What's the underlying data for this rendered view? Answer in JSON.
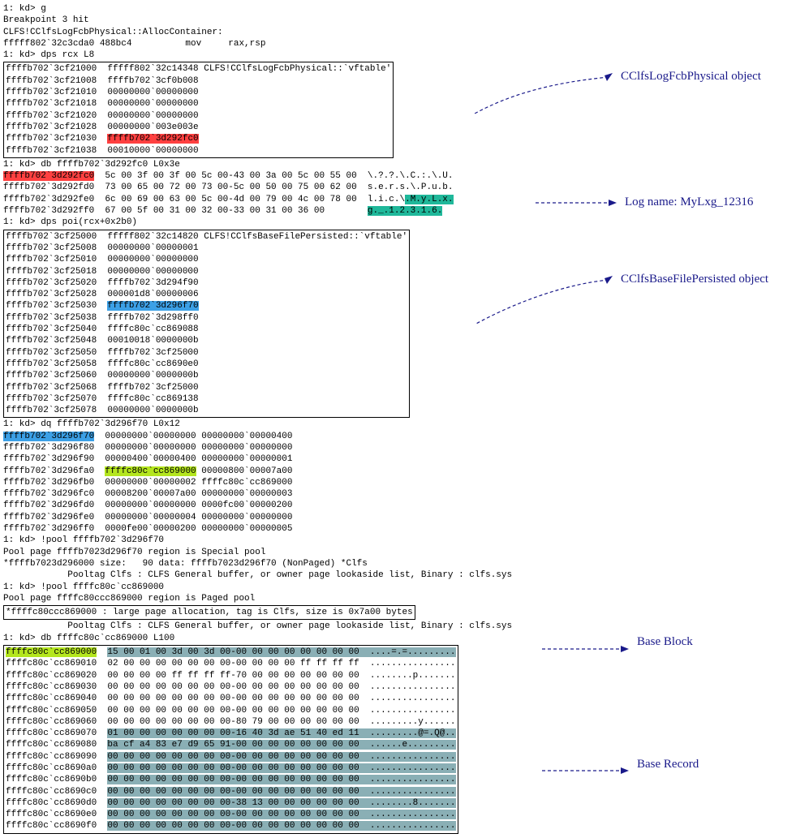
{
  "block1": {
    "l1": "1: kd> g",
    "l2": "Breakpoint 3 hit",
    "l3": "CLFS!CClfsLogFcbPhysical::AllocContainer:",
    "l4": "fffff802`32c3cda0 488bc4          mov     rax,rsp",
    "l5": "1: kd> dps rcx L8"
  },
  "box1": {
    "l1": "ffffb702`3cf21000  fffff802`32c14348 CLFS!CClfsLogFcbPhysical::`vftable'",
    "l2": "ffffb702`3cf21008  ffffb702`3cf0b008",
    "l3": "ffffb702`3cf21010  00000000`00000000",
    "l4": "ffffb702`3cf21018  00000000`00000000",
    "l5": "ffffb702`3cf21020  00000000`00000000",
    "l6": "ffffb702`3cf21028  00000000`003e003e",
    "l7a": "ffffb702`3cf21030  ",
    "l7b": "ffffb702`3d292fc0",
    "l8": "ffffb702`3cf21038  00010000`00000000"
  },
  "block2": {
    "l1": "1: kd> db ffffb702`3d292fc0 L0x3e",
    "r1a": "ffffb702`3d292fc0",
    "r1b": "  5c 00 3f 00 3f 00 5c 00-43 00 3a 00 5c 00 55 00  \\.?.?.\\.C.:.\\.U.",
    "r2": "ffffb702`3d292fd0  73 00 65 00 72 00 73 00-5c 00 50 00 75 00 62 00  s.e.r.s.\\.P.u.b.",
    "r3a": "ffffb702`3d292fe0  6c 00 69 00 63 00 5c 00-4d 00 79 00 4c 00 78 00  l.i.c.\\",
    "r3b": ".M.y.L.x.",
    "r4a": "ffffb702`3d292ff0  67 00 5f 00 31 00 32 00-33 00 31 00 36 00        ",
    "r4b": "g._.1.2.3.1.6.",
    "l5": "1: kd> dps poi(rcx+0x2b0)"
  },
  "box2": {
    "l1": "ffffb702`3cf25000  fffff802`32c14820 CLFS!CClfsBaseFilePersisted::`vftable'",
    "l2": "ffffb702`3cf25008  00000000`00000001",
    "l3": "ffffb702`3cf25010  00000000`00000000",
    "l4": "ffffb702`3cf25018  00000000`00000000",
    "l5": "ffffb702`3cf25020  ffffb702`3d294f90",
    "l6": "ffffb702`3cf25028  000001d8`00000006",
    "l7a": "ffffb702`3cf25030  ",
    "l7b": "ffffb702`3d296f70",
    "l8": "ffffb702`3cf25038  ffffb702`3d298ff0",
    "l9": "ffffb702`3cf25040  ffffc80c`cc869088",
    "l10": "ffffb702`3cf25048  00010018`0000000b",
    "l11": "ffffb702`3cf25050  ffffb702`3cf25000",
    "l12": "ffffb702`3cf25058  ffffc80c`cc8690e0",
    "l13": "ffffb702`3cf25060  00000000`0000000b",
    "l14": "ffffb702`3cf25068  ffffb702`3cf25000",
    "l15": "ffffb702`3cf25070  ffffc80c`cc869138",
    "l16": "ffffb702`3cf25078  00000000`0000000b"
  },
  "block3": {
    "l1": "1: kd> dq ffffb702`3d296f70 L0x12",
    "r1a": "ffffb702`3d296f70",
    "r1b": "  00000000`00000000 00000000`00000400",
    "r2": "ffffb702`3d296f80  00000000`00000000 00000000`00000000",
    "r3": "ffffb702`3d296f90  00000400`00000400 00000000`00000001",
    "r4a": "ffffb702`3d296fa0  ",
    "r4b": "ffffc80c`cc869000",
    "r4c": " 00000800`00007a00",
    "r5": "ffffb702`3d296fb0  00000000`00000002 ffffc80c`cc869000",
    "r6": "ffffb702`3d296fc0  00008200`00007a00 00000000`00000003",
    "r7": "ffffb702`3d296fd0  00000000`00000000 0000fc00`00000200",
    "r8": "ffffb702`3d296fe0  00000000`00000004 00000000`00000000",
    "r9": "ffffb702`3d296ff0  0000fe00`00000200 00000000`00000005",
    "l10": "1: kd> !pool ffffb702`3d296f70",
    "l11": "Pool page ffffb7023d296f70 region is Special pool",
    "l12": "*ffffb7023d296000 size:   90 data: ffffb7023d296f70 (NonPaged) *Clfs",
    "l13": "            Pooltag Clfs : CLFS General buffer, or owner page lookaside list, Binary : clfs.sys",
    "l14": "1: kd> !pool ffffc80c`cc869000",
    "l15": "Pool page ffffc80ccc869000 region is Paged pool"
  },
  "box3": {
    "l1": "*ffffc80ccc869000 : large page allocation, tag is Clfs, size is 0x7a00 bytes"
  },
  "block4": {
    "l1": "            Pooltag Clfs : CLFS General buffer, or owner page lookaside list, Binary : clfs.sys",
    "l2": "1: kd> db ffffc80c`cc869000 L100"
  },
  "box4": {
    "r1a": "ffffc80c`cc869000",
    "r1b": "  ",
    "r1c": "15 00 01 00 3d 00 3d 00-00 00 00 00 00 00 00 00  ....=.=.........",
    "r2": "ffffc80c`cc869010  02 00 00 00 00 00 00 00-00 00 00 00 ff ff ff ff  ................",
    "r3": "ffffc80c`cc869020  00 00 00 00 ff ff ff ff-70 00 00 00 00 00 00 00  ........p.......",
    "r4": "ffffc80c`cc869030  00 00 00 00 00 00 00 00-00 00 00 00 00 00 00 00  ................",
    "r5": "ffffc80c`cc869040  00 00 00 00 00 00 00 00-00 00 00 00 00 00 00 00  ................",
    "r6": "ffffc80c`cc869050  00 00 00 00 00 00 00 00-00 00 00 00 00 00 00 00  ................",
    "r7": "ffffc80c`cc869060  00 00 00 00 00 00 00 00-80 79 00 00 00 00 00 00  .........y......",
    "r8a": "ffffc80c`cc869070  ",
    "r8b": "01 00 00 00 00 00 00 00-16 40 3d ae 51 40 ed 11  .........@=.Q@..",
    "r9a": "ffffc80c`cc869080  ",
    "r9b": "ba cf a4 83 e7 d9 65 91-00 00 00 00 00 00 00 00  ......e.........",
    "r10a": "ffffc80c`cc869090  ",
    "r10b": "00 00 00 00 00 00 00 00-00 00 00 00 00 00 00 00  ................",
    "r11a": "ffffc80c`cc8690a0  ",
    "r11b": "00 00 00 00 00 00 00 00-00 00 00 00 00 00 00 00  ................",
    "r12a": "ffffc80c`cc8690b0  ",
    "r12b": "00 00 00 00 00 00 00 00-00 00 00 00 00 00 00 00  ................",
    "r13a": "ffffc80c`cc8690c0  ",
    "r13b": "00 00 00 00 00 00 00 00-00 00 00 00 00 00 00 00  ................",
    "r14a": "ffffc80c`cc8690d0  ",
    "r14b": "00 00 00 00 00 00 00 00-38 13 00 00 00 00 00 00  ........8.......",
    "r15a": "ffffc80c`cc8690e0  ",
    "r15b": "00 00 00 00 00 00 00 00-00 00 00 00 00 00 00 00  ................",
    "r16a": "ffffc80c`cc8690f0  ",
    "r16b": "00 00 00 00 00 00 00 00-00 00 00 00 00 00 00 00  ................"
  },
  "annotations": {
    "a1": "CClfsLogFcbPhysical object",
    "a2": "Log name: MyLxg_12316",
    "a3": "CClfsBaseFilePersisted object",
    "a4": "Base Block",
    "a5": "Base Record"
  }
}
